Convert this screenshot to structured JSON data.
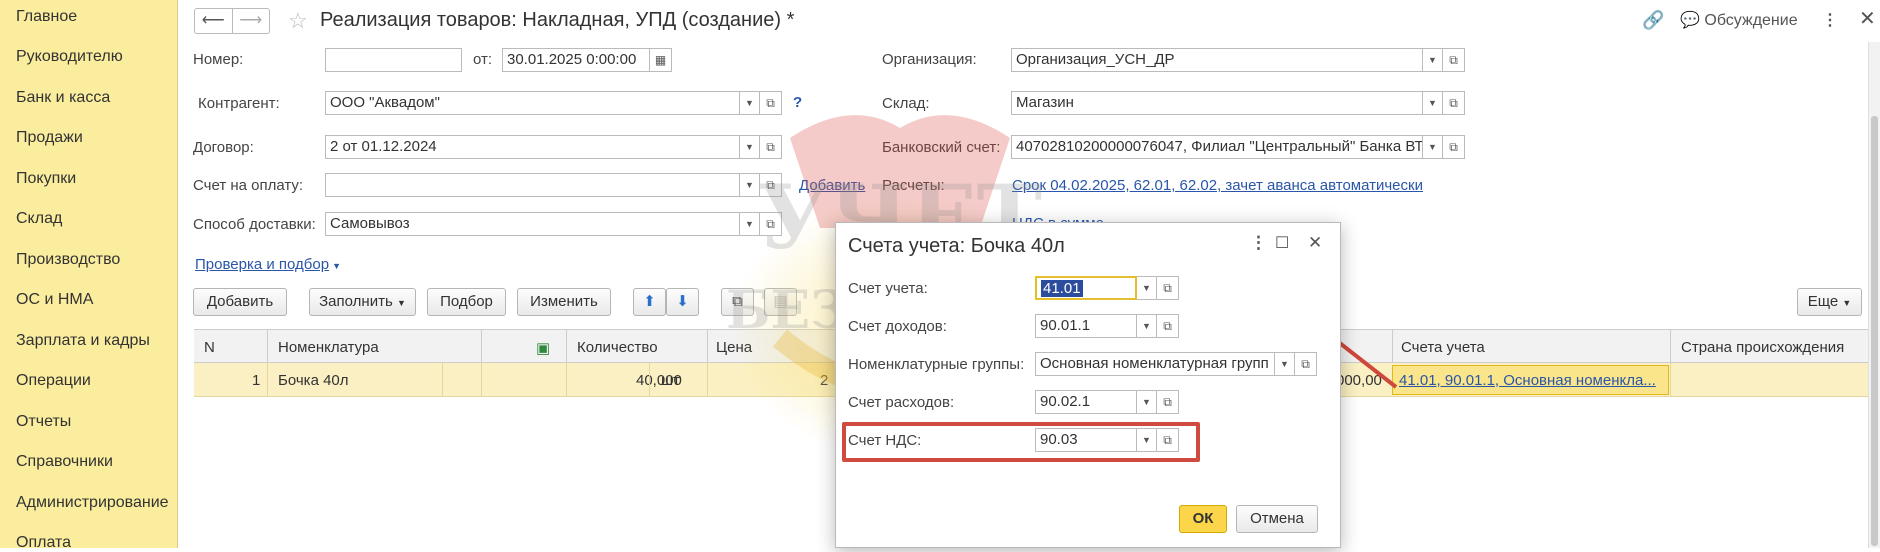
{
  "sidebar": {
    "items": [
      "Главное",
      "Руководителю",
      "Банк и касса",
      "Продажи",
      "Покупки",
      "Склад",
      "Производство",
      "ОС и НМА",
      "Зарплата и кадры",
      "Операции",
      "Отчеты",
      "Справочники",
      "Администрирование",
      "Оплата"
    ]
  },
  "topbar": {
    "title": "Реализация товаров: Накладная, УПД (создание) *",
    "discuss_label": "Обсуждение",
    "back_glyph": "⟵",
    "forward_glyph": "⟶"
  },
  "form": {
    "number_label": "Номер:",
    "number_value": "",
    "from_label": "от:",
    "date_value": "30.01.2025  0:00:00",
    "org_label": "Организация:",
    "org_value": "Организация_УСН_ДР",
    "counterparty_label": "Контрагент:",
    "counterparty_value": "ООО \"Аквадом\"",
    "warehouse_label": "Склад:",
    "warehouse_value": "Магазин",
    "contract_label": "Договор:",
    "contract_value": "2 от 01.12.2024",
    "bank_label": "Банковский счет:",
    "bank_value": "40702810200000076047, Филиал \"Центральный\" Банка ВТ",
    "invoice_label": "Счет на оплату:",
    "invoice_value": "",
    "add_link": "Добавить",
    "settlements_label": "Расчеты:",
    "settlements_link": "Срок 04.02.2025, 62.01, 62.02, зачет аванса автоматически",
    "vat_link": "НДС в сумме",
    "delivery_label": "Способ доставки:",
    "delivery_value": "Самовывоз",
    "check_link": "Проверка и подбор",
    "help_glyph": "?"
  },
  "toolbar": {
    "add": "Добавить",
    "fill": "Заполнить",
    "pick": "Подбор",
    "edit": "Изменить",
    "more": "Еще"
  },
  "table": {
    "headers": {
      "n": "N",
      "nomenclature": "Номенклатура",
      "qty": "Количество",
      "price": "Цена",
      "accounts": "Счета учета",
      "country": "Страна происхождения"
    },
    "rows": [
      {
        "n": "1",
        "nomenclature": "Бочка 40л",
        "qty": "40,000",
        "unit": "шт",
        "price": "2",
        "sum": "000,00",
        "accounts": "41.01, 90.01.1, Основная номенкла...",
        "country": ""
      }
    ]
  },
  "dialog": {
    "title": "Счета учета: Бочка 40л",
    "fields": [
      {
        "label": "Счет учета:",
        "value": "41.01"
      },
      {
        "label": "Счет доходов:",
        "value": "90.01.1"
      },
      {
        "label": "Номенклатурные группы:",
        "value": "Основная номенклатурная групп"
      },
      {
        "label": "Счет расходов:",
        "value": "90.02.1"
      },
      {
        "label": "Счет НДС:",
        "value": "90.03"
      }
    ],
    "ok": "ОК",
    "cancel": "Отмена"
  },
  "colors": {
    "sidebar_bg": "#fbed9e",
    "selected_row": "#fbf0c4",
    "ok_button": "#fbd64b",
    "highlight_box": "#cf4b40",
    "link": "#2a56a9"
  }
}
